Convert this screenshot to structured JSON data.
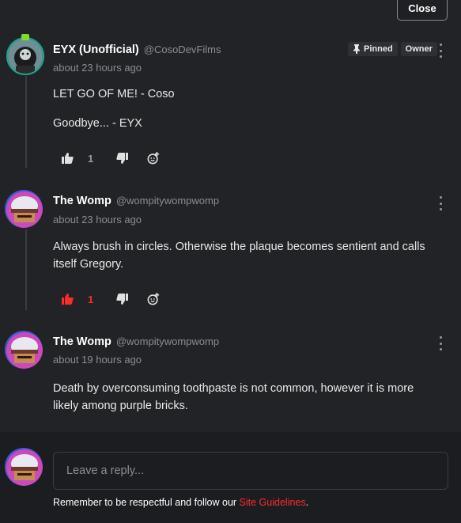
{
  "close_label": "Close",
  "comments": [
    {
      "author": "EYX (Unofficial)",
      "handle": "@CosoDevFilms",
      "time": "about 23 hours ago",
      "lines": [
        "LET GO OF ME! - Coso",
        "Goodbye... - EYX"
      ],
      "badges": {
        "pinned": "Pinned",
        "owner": "Owner"
      },
      "likes": "1",
      "liked": false
    },
    {
      "author": "The Womp",
      "handle": "@wompitywompwomp",
      "time": "about 23 hours ago",
      "lines": [
        "Always brush in circles. Otherwise the plaque becomes sentient and calls itself Gregory."
      ],
      "likes": "1",
      "liked": true
    },
    {
      "author": "The Womp",
      "handle": "@wompitywompwomp",
      "time": "about 19 hours ago",
      "lines": [
        "Death by overconsuming toothpaste is not common, however it is more likely among purple bricks."
      ]
    }
  ],
  "reply": {
    "placeholder": "Leave a reply...",
    "note_prefix": "Remember to be respectful and follow our",
    "note_link": "Site Guidelines",
    "note_suffix": "."
  },
  "colors": {
    "accent": "#ff2b2b",
    "background": "#222326"
  }
}
